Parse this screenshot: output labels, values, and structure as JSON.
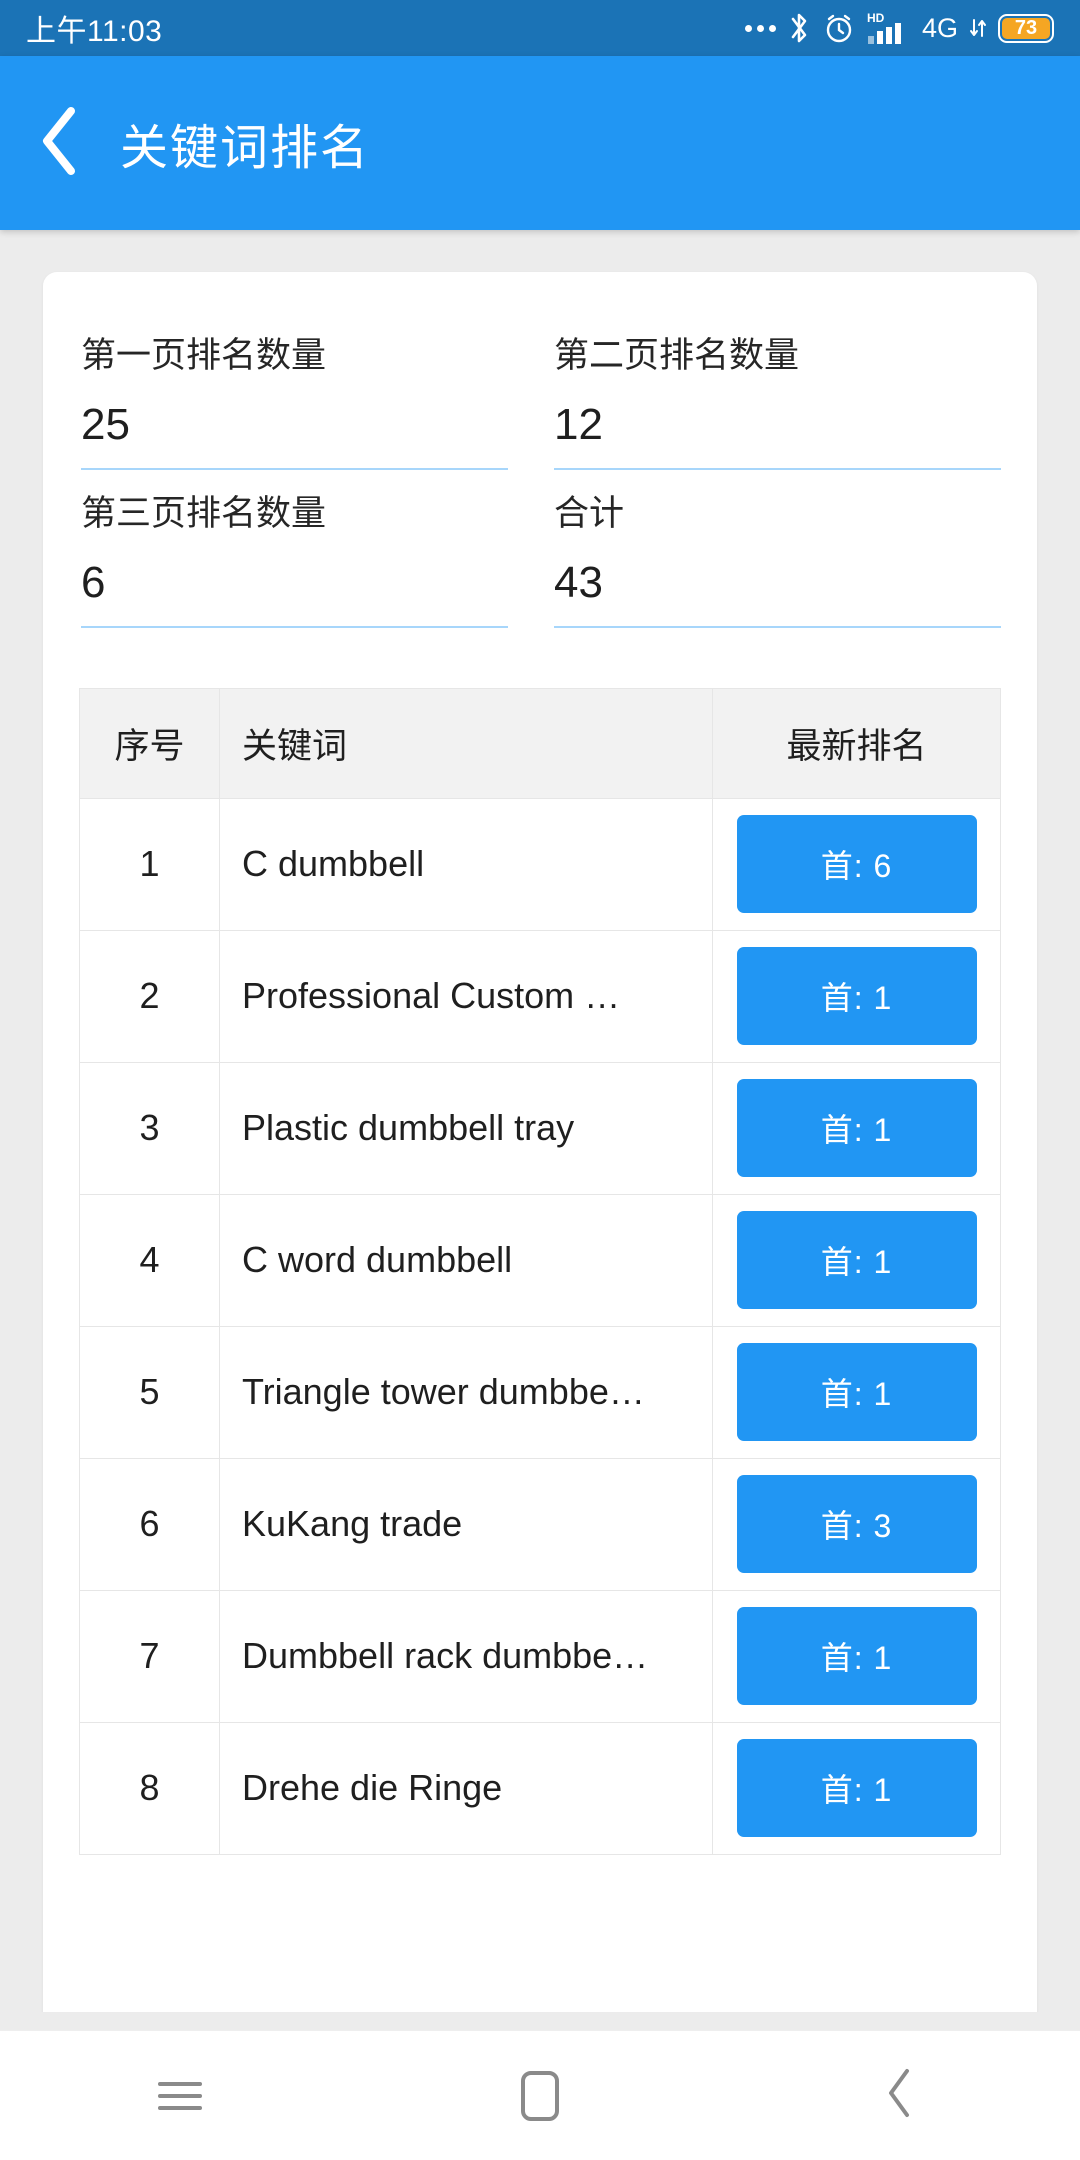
{
  "statusbar": {
    "time": "上午11:03",
    "icons": [
      "more-dots-icon",
      "bluetooth-icon",
      "alarm-icon",
      "hd-signal-icon",
      "4g-icon",
      "data-transfer-icon",
      "battery-icon"
    ],
    "network_label": "4G",
    "hd_label": "HD",
    "battery_level": "73",
    "battery_color": "#f5a623",
    "background": "#1b73b6"
  },
  "appbar": {
    "back_icon": "chevron-left-icon",
    "title": "关键词排名",
    "background": "#2196f3"
  },
  "stats": [
    {
      "label": "第一页排名数量",
      "value": "25"
    },
    {
      "label": "第二页排名数量",
      "value": "12"
    },
    {
      "label": "第三页排名数量",
      "value": "6"
    },
    {
      "label": "合计",
      "value": "43"
    }
  ],
  "table": {
    "headers": {
      "index": "序号",
      "keyword": "关键词",
      "rank": "最新排名"
    },
    "rows": [
      {
        "index": "1",
        "keyword": "C dumbbell",
        "rank": "首: 6"
      },
      {
        "index": "2",
        "keyword": "Professional Custom …",
        "rank": "首: 1"
      },
      {
        "index": "3",
        "keyword": "Plastic dumbbell tray",
        "rank": "首: 1"
      },
      {
        "index": "4",
        "keyword": "C word dumbbell",
        "rank": "首: 1"
      },
      {
        "index": "5",
        "keyword": "Triangle tower dumbbe…",
        "rank": "首: 1"
      },
      {
        "index": "6",
        "keyword": "KuKang trade",
        "rank": "首: 3"
      },
      {
        "index": "7",
        "keyword": "Dumbbell rack dumbbe…",
        "rank": "首: 1"
      },
      {
        "index": "8",
        "keyword": "Drehe die Ringe",
        "rank": "首: 1"
      }
    ],
    "badge_color": "#2196f3"
  },
  "navbar": {
    "menu_icon": "menu-icon",
    "home_icon": "home-icon",
    "back_icon": "back-chevron-icon"
  },
  "theme": {
    "accent": "#2196f3",
    "underline": "#a7d6fb",
    "page_bg": "#ececec"
  }
}
